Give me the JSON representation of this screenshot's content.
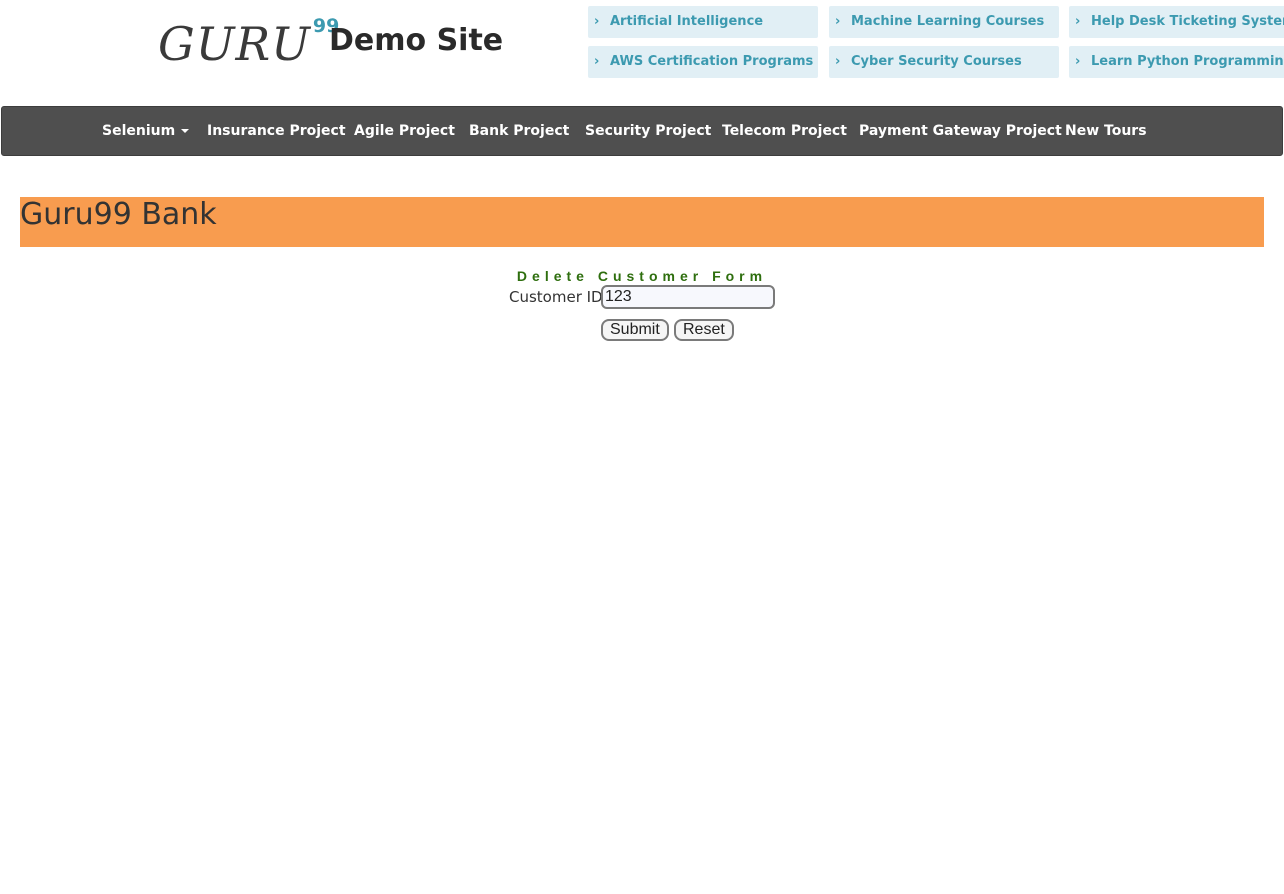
{
  "header": {
    "logo_text": "GURU",
    "logo_sup": "99",
    "site_title": "Demo Site"
  },
  "top_links": [
    {
      "label": "Artificial Intelligence"
    },
    {
      "label": "Machine Learning Courses"
    },
    {
      "label": "Help Desk Ticketing System"
    },
    {
      "label": "AWS Certification Programs"
    },
    {
      "label": "Cyber Security Courses"
    },
    {
      "label": "Learn Python Programming"
    }
  ],
  "nav": {
    "items": [
      {
        "label": "Selenium"
      },
      {
        "label": "Insurance Project"
      },
      {
        "label": "Agile Project"
      },
      {
        "label": "Bank Project"
      },
      {
        "label": "Security Project"
      },
      {
        "label": "Telecom Project"
      },
      {
        "label": "Payment Gateway Project"
      },
      {
        "label": "New Tours"
      }
    ]
  },
  "bank": {
    "title": "Guru99 Bank"
  },
  "form": {
    "title": "Delete Customer Form",
    "customer_id_label": "Customer ID",
    "customer_id_value": "123",
    "submit_label": "Submit",
    "reset_label": "Reset"
  },
  "colors": {
    "nav_bg": "#4f4f4f",
    "banner_bg": "#f89c4f",
    "link_text": "#3c9ab0",
    "link_bg": "#e1eff5",
    "form_title": "#2e6e0e"
  }
}
